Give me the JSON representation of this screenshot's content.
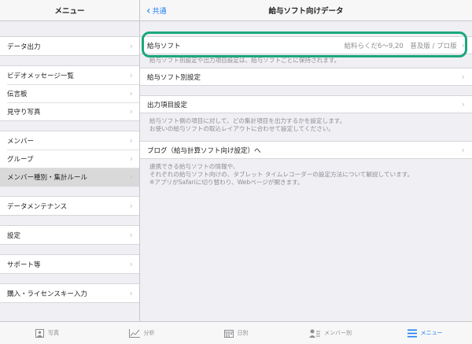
{
  "sidebar": {
    "title": "メニュー",
    "groups": [
      [
        "データ出力"
      ],
      [
        "ビデオメッセージ一覧",
        "伝言板",
        "見守り写真"
      ],
      [
        "メンバー",
        "グループ",
        "メンバー種別・集計ルール"
      ],
      [
        "データメンテナンス"
      ],
      [
        "設定"
      ],
      [
        "サポート等"
      ],
      [
        "購入・ライセンスキー入力"
      ]
    ],
    "selected": "メンバー種別・集計ルール"
  },
  "main": {
    "back_label": "共通",
    "title": "給与ソフト向けデータ",
    "salary_software": {
      "label": "給与ソフト",
      "value": "給料らくだ6〜9,20　普及版 / プロ版",
      "note": "給与ソフト別設定や出力項目設定は、給与ソフトごとに保持されます。"
    },
    "per_software_settings": {
      "label": "給与ソフト別設定"
    },
    "output_items": {
      "label": "出力項目設定",
      "note_1": "給与ソフト側の項目に対して、どの集計項目を出力するかを設定します。",
      "note_2": "お使いの給与ソフトの取込レイアウトに合わせて設定してください。"
    },
    "blog": {
      "label": "ブログ（給与計算ソフト向け設定）へ",
      "note_1": "連携できる給与ソフトの情報や、",
      "note_2": "それぞれの給与ソフト向けの、タブレット タイムレコーダーの設定方法について解説しています。",
      "note_3": "※アプリがSafariに切り替わり、Webページが開きます。"
    }
  },
  "tabs": [
    {
      "label": "写真",
      "icon": "photo-icon"
    },
    {
      "label": "分析",
      "icon": "chart-icon"
    },
    {
      "label": "日別",
      "icon": "calendar-icon"
    },
    {
      "label": "メンバー別",
      "icon": "member-icon"
    },
    {
      "label": "メニュー",
      "icon": "menu-icon",
      "active": true
    }
  ],
  "colors": {
    "accent": "#1a7cf5",
    "highlight": "#1aa87a"
  }
}
